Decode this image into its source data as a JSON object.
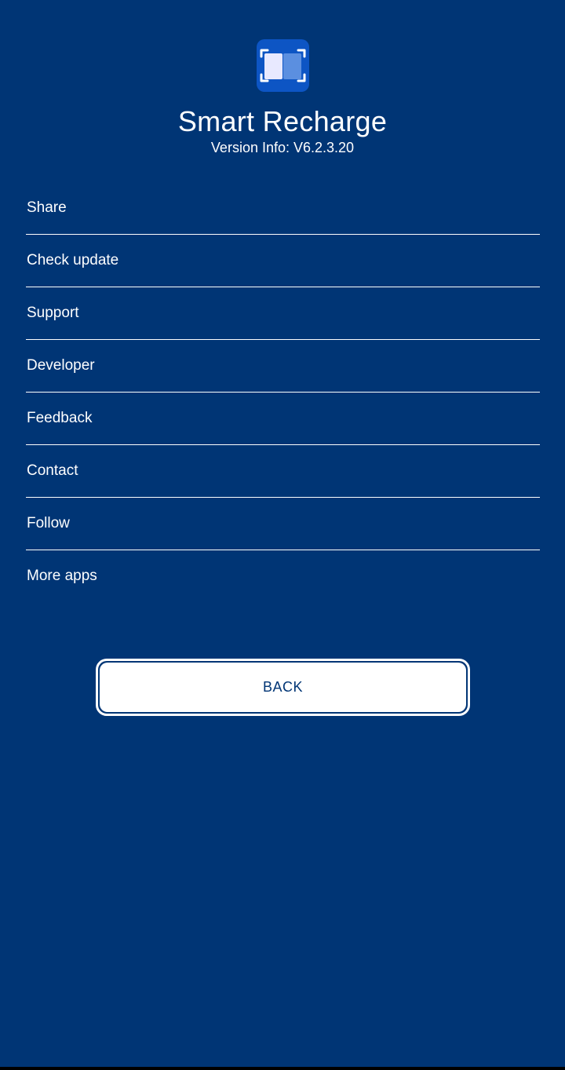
{
  "app": {
    "name": "Smart Recharge",
    "version": "Version Info: V6.2.3.20",
    "icon": "scan-card-icon"
  },
  "menu": {
    "items": [
      {
        "label": "Share"
      },
      {
        "label": "Check update"
      },
      {
        "label": "Support"
      },
      {
        "label": "Developer"
      },
      {
        "label": "Feedback"
      },
      {
        "label": "Contact"
      },
      {
        "label": "Follow"
      },
      {
        "label": "More apps"
      }
    ]
  },
  "actions": {
    "back_label": "BACK"
  },
  "colors": {
    "background": "#003575",
    "icon_bg": "#0d55c4",
    "text": "#ffffff",
    "button_text": "#003575"
  }
}
